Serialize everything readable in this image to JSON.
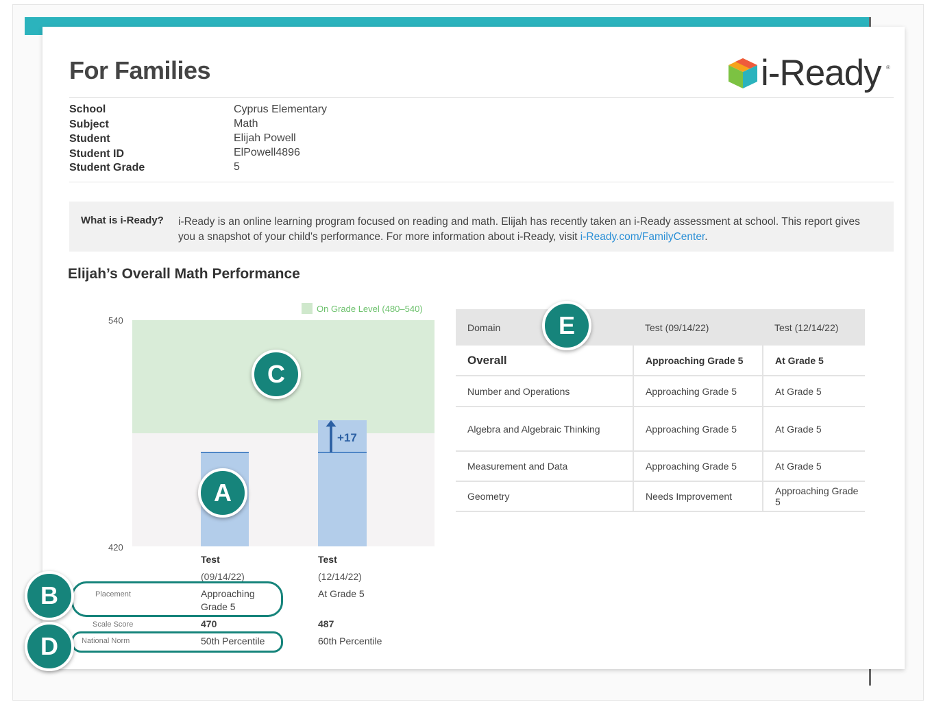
{
  "header": {
    "title": "For Families",
    "logo_text": "i-Ready",
    "logo_tm": "®"
  },
  "info": {
    "labels": [
      "School",
      "Subject",
      "Student",
      "Student ID",
      "Student Grade"
    ],
    "values": [
      "Cyprus Elementary",
      "Math",
      "Elijah Powell",
      "ElPowell4896",
      "5"
    ]
  },
  "what_is": {
    "label": "What is i-Ready?",
    "text": "i-Ready is an online learning program focused on reading and math. Elijah has recently taken an i-Ready assessment at school. This report gives you a snapshot of your child's performance. For more information about i-Ready, visit ",
    "link": "i-Ready.com/FamilyCenter",
    "end": "."
  },
  "section_title": "Elijah’s Overall Math Performance",
  "chart_data": {
    "type": "bar",
    "categories": [
      "Test (09/14/22)",
      "Test (12/14/22)"
    ],
    "values": [
      470,
      487
    ],
    "ylim": [
      420,
      540
    ],
    "yticks": [
      "540",
      "420"
    ],
    "band": {
      "label": "On Grade Level (480–540)",
      "from": 480,
      "to": 540
    },
    "gain_label": "+17",
    "columns": [
      {
        "head": "Test",
        "date": "(09/14/22)",
        "placement": "Approaching Grade 5",
        "scale_score": "470",
        "national_norm": "50th Percentile"
      },
      {
        "head": "Test",
        "date": "(12/14/22)",
        "placement": "At Grade 5",
        "scale_score": "487",
        "national_norm": "60th Percentile"
      }
    ],
    "row_labels": {
      "placement": "Placement",
      "scale_score": "Scale Score",
      "national_norm": "National Norm"
    }
  },
  "table": {
    "headers": [
      "Domain",
      "Test (09/14/22)",
      "Test (12/14/22)"
    ],
    "rows": [
      [
        "Overall",
        "Approaching Grade 5",
        "At Grade 5"
      ],
      [
        "Number and Operations",
        "Approaching Grade 5",
        "At Grade 5"
      ],
      [
        "Algebra and Algebraic Thinking",
        "Approaching Grade 5",
        "At Grade 5"
      ],
      [
        "Measurement and Data",
        "Approaching Grade 5",
        "At Grade 5"
      ],
      [
        "Geometry",
        "Needs Improvement",
        "Approaching Grade 5"
      ]
    ]
  },
  "callouts": [
    "A",
    "B",
    "C",
    "D",
    "E"
  ],
  "colors": {
    "teal": "#16847b",
    "bar": "#b3cdea",
    "band": "#d9ecd8",
    "link": "#2a8fd6"
  }
}
